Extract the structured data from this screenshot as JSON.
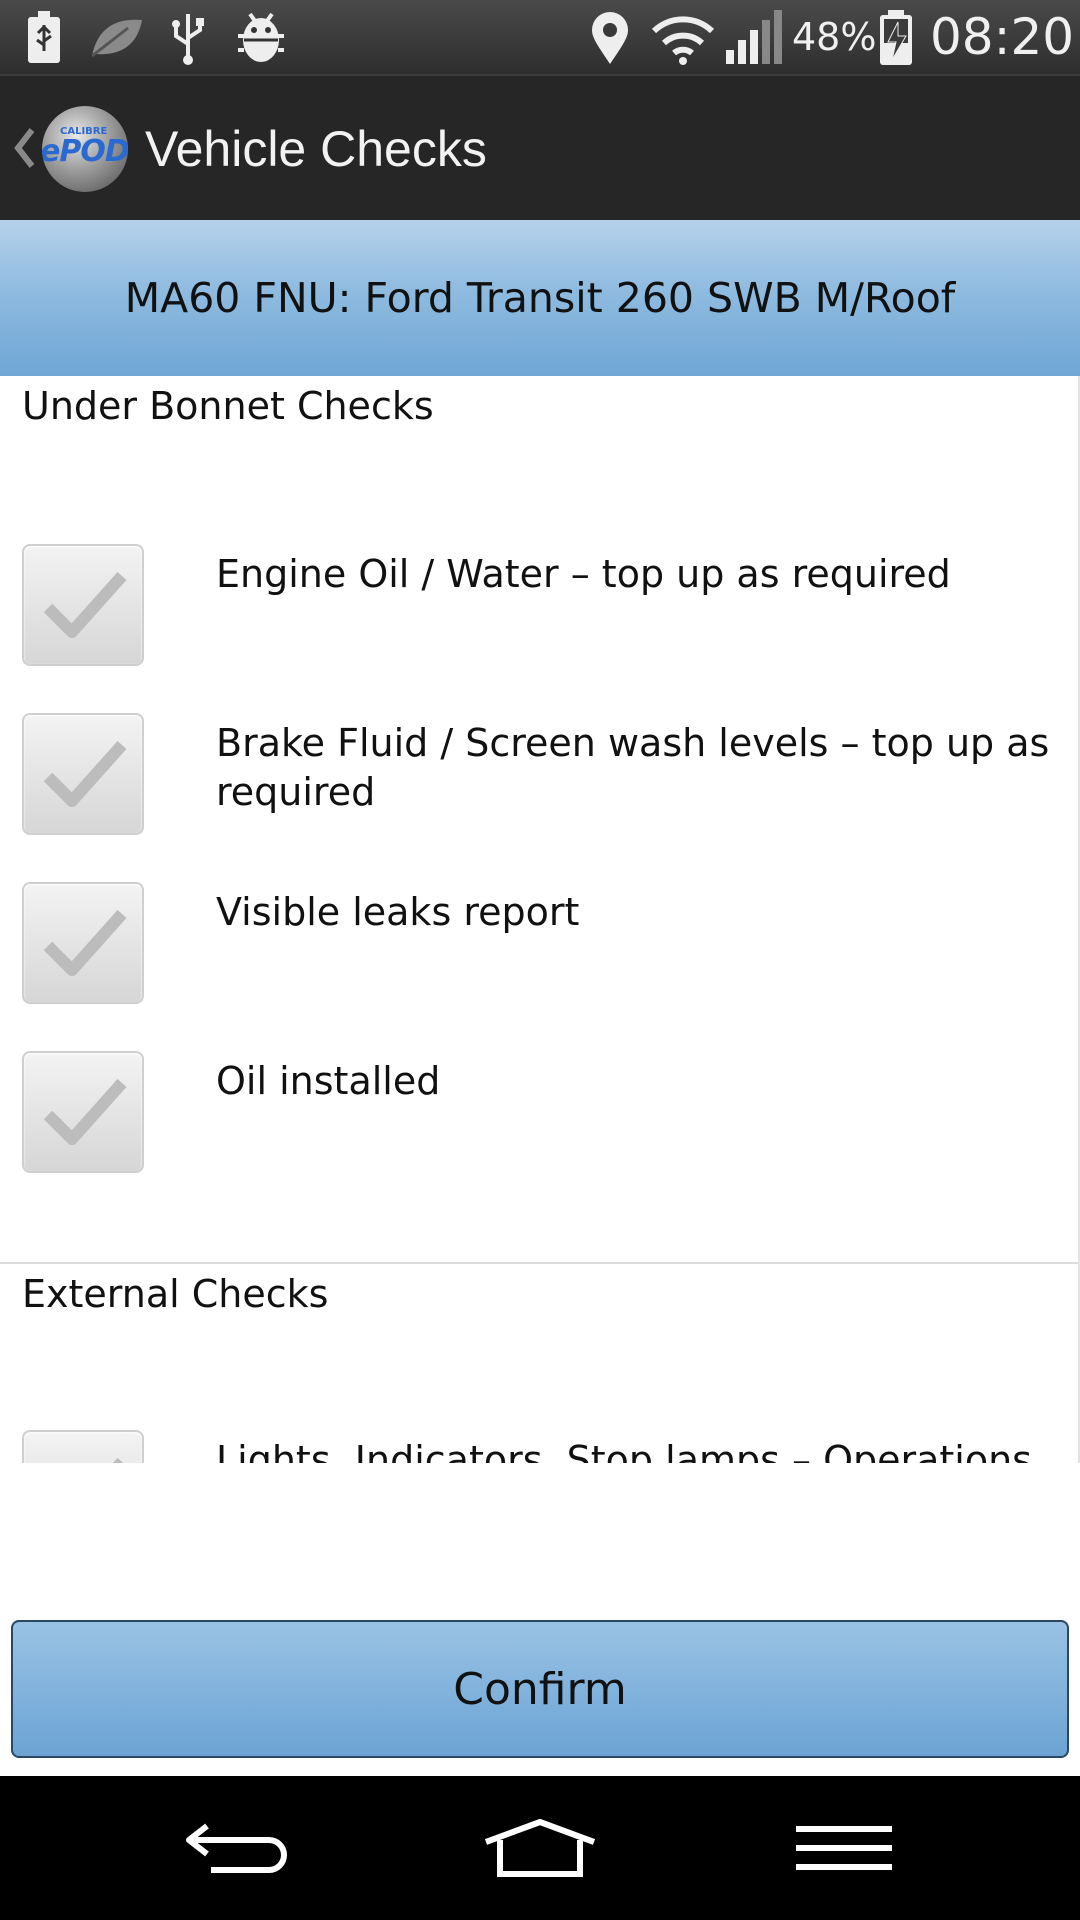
{
  "status_bar": {
    "battery_percent": "48%",
    "time": "08:20",
    "icons": [
      "usb-storage-icon",
      "leaf-icon",
      "usb-icon",
      "android-debug-icon",
      "location-icon",
      "wifi-icon",
      "signal-icon",
      "battery-charging-icon"
    ]
  },
  "action_bar": {
    "title": "Vehicle Checks",
    "logo_text": "ePOD",
    "logo_small_text": "CALIBRE"
  },
  "vehicle": {
    "header": "MA60 FNU: Ford Transit 260 SWB M/Roof"
  },
  "sections": [
    {
      "title": "Under Bonnet Checks",
      "items": [
        {
          "label": "Engine Oil / Water – top up as required",
          "checked": true
        },
        {
          "label": "Brake Fluid / Screen wash levels – top up as required",
          "checked": true
        },
        {
          "label": "Visible leaks report",
          "checked": true
        },
        {
          "label": "Oil installed",
          "checked": true
        }
      ]
    },
    {
      "title": "External Checks",
      "items": [
        {
          "label": "Lights, Indicators, Stop lamps – Operations /",
          "checked": true
        }
      ]
    }
  ],
  "confirm": {
    "label": "Confirm"
  },
  "nav": {
    "icons": [
      "back-icon",
      "home-icon",
      "menu-icon"
    ]
  },
  "colors": {
    "header_blue": "#8fbbe0",
    "action_bar": "#262626",
    "status_bar": "#3a3a3a"
  }
}
